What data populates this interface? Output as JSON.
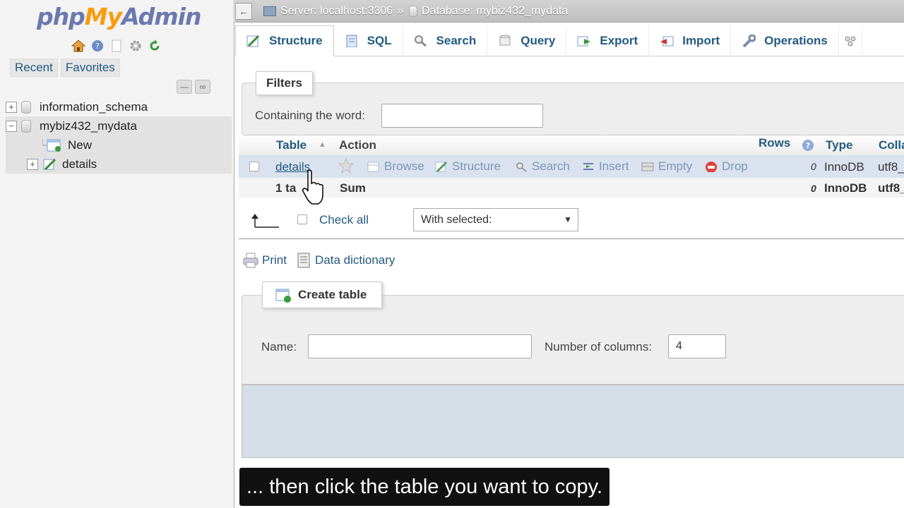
{
  "sidebar": {
    "logo": {
      "php": "php",
      "my": "My",
      "admin": "Admin"
    },
    "tabs": [
      "Recent",
      "Favorites"
    ],
    "tree": [
      {
        "label": "information_schema"
      },
      {
        "label": "mybiz432_mydata"
      },
      {
        "label": "New"
      },
      {
        "label": "details"
      }
    ]
  },
  "breadcrumb": {
    "server": "Server: localhost:3306",
    "separator": "»",
    "database": "Database: mybiz432_mydata"
  },
  "tabs": [
    "Structure",
    "SQL",
    "Search",
    "Query",
    "Export",
    "Import",
    "Operations"
  ],
  "filters": {
    "legend": "Filters",
    "label": "Containing the word:",
    "value": ""
  },
  "table": {
    "headers": {
      "table": "Table",
      "action": "Action",
      "rows": "Rows",
      "type": "Type",
      "collation": "Colla"
    },
    "rows": [
      {
        "name": "details",
        "actions": [
          "Browse",
          "Structure",
          "Search",
          "Insert",
          "Empty",
          "Drop"
        ],
        "rows": "0",
        "type": "InnoDB",
        "collation": "utf8_"
      }
    ],
    "summary": {
      "name": "1 ta",
      "action": "Sum",
      "rows": "0",
      "type": "InnoDB",
      "collation": "utf8_"
    }
  },
  "bulk": {
    "check_all": "Check all",
    "with_selected": "With selected:"
  },
  "links": {
    "print": "Print",
    "data_dictionary": "Data dictionary"
  },
  "create_table": {
    "legend": "Create table",
    "name_label": "Name:",
    "name_value": "",
    "columns_label": "Number of columns:",
    "columns_value": "4"
  },
  "subtitle": "... then click the table you want to copy.",
  "colors": {
    "link": "#235a81",
    "logo_blue": "#6c78af",
    "logo_orange": "#f89c0e"
  }
}
